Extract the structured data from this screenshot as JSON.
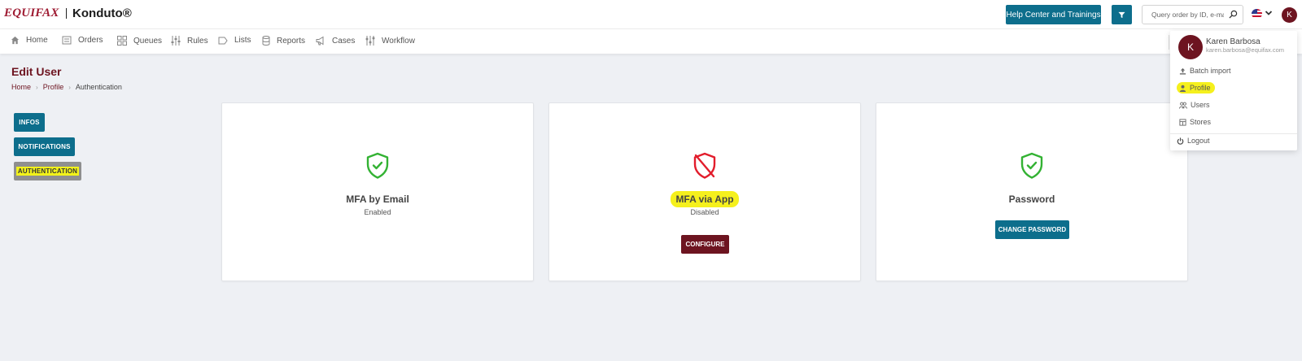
{
  "header": {
    "brand": "EQUIFAX",
    "product": "Konduto®",
    "help_label": "Help Center and Trainings",
    "search_placeholder": "Query order by ID, e-mai",
    "avatar_initial": "K"
  },
  "nav": {
    "items": [
      {
        "label": "Home",
        "icon": "home-icon"
      },
      {
        "label": "Orders",
        "icon": "orders-icon"
      },
      {
        "label": "Queues",
        "icon": "grid-icon"
      },
      {
        "label": "Rules",
        "icon": "sliders-icon"
      },
      {
        "label": "Lists",
        "icon": "tag-icon"
      },
      {
        "label": "Reports",
        "icon": "database-icon"
      },
      {
        "label": "Cases",
        "icon": "megaphone-icon"
      },
      {
        "label": "Workflow",
        "icon": "workflow-icon"
      }
    ]
  },
  "page": {
    "title": "Edit User",
    "breadcrumb": [
      "Home",
      "Profile",
      "Authentication"
    ]
  },
  "side_tabs": [
    "INFOS",
    "NOTIFICATIONS",
    "AUTHENTICATION"
  ],
  "active_tab": "AUTHENTICATION",
  "cards": [
    {
      "title": "MFA by Email",
      "status": "Enabled",
      "icon": "shield-check-icon"
    },
    {
      "title": "MFA via App",
      "status": "Disabled",
      "icon": "shield-off-icon",
      "button": "CONFIGURE"
    },
    {
      "title": "Password",
      "status": "",
      "icon": "shield-check-icon",
      "button": "CHANGE PASSWORD"
    }
  ],
  "user_menu": {
    "initial": "K",
    "name": "Karen Barbosa",
    "email": "karen.barbosa@equifax.com",
    "items": [
      "Batch import",
      "Profile",
      "Users",
      "Stores",
      "Logout"
    ]
  },
  "colors": {
    "primary": "#0d6e8c",
    "brand_red": "#6d1420",
    "enabled_green": "#33b233",
    "disabled_red": "#e21d2c",
    "highlight": "#f5f01d"
  }
}
